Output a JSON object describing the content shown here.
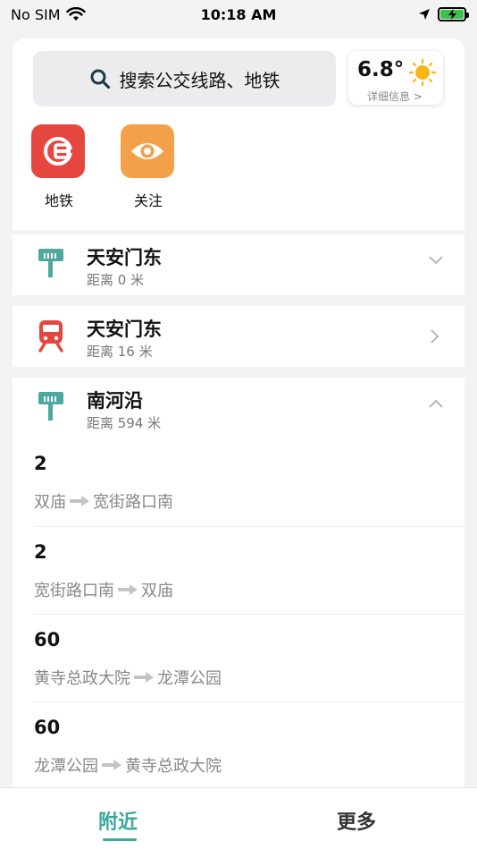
{
  "status_bar": {
    "carrier": "No SIM",
    "time": "10:18 AM"
  },
  "search": {
    "placeholder": "搜索公交线路、地铁"
  },
  "weather": {
    "temperature": "6.8°",
    "detail_link": "详细信息 >"
  },
  "shortcuts": [
    {
      "label": "地铁",
      "color": "#e5473e",
      "icon": "subway-logo-icon"
    },
    {
      "label": "关注",
      "color": "#f3a04b",
      "icon": "eye-icon"
    }
  ],
  "stations": [
    {
      "name": "天安门东",
      "distance": "距离 0 米",
      "type": "bus",
      "chevron": "down"
    },
    {
      "name": "天安门东",
      "distance": "距离 16 米",
      "type": "subway",
      "chevron": "right"
    },
    {
      "name": "南河沿",
      "distance": "距离 594 米",
      "type": "bus",
      "chevron": "up",
      "routes": [
        {
          "number": "2",
          "from": "双庙",
          "to": "宽街路口南"
        },
        {
          "number": "2",
          "from": "宽街路口南",
          "to": "双庙"
        },
        {
          "number": "60",
          "from": "黄寺总政大院",
          "to": "龙潭公园"
        },
        {
          "number": "60",
          "from": "龙潭公园",
          "to": "黄寺总政大院"
        }
      ]
    }
  ],
  "tabs": {
    "nearby": "附近",
    "more": "更多"
  },
  "colors": {
    "accent": "#3aa99c",
    "bus_icon": "#4fa89e",
    "subway_icon": "#e5473e"
  }
}
